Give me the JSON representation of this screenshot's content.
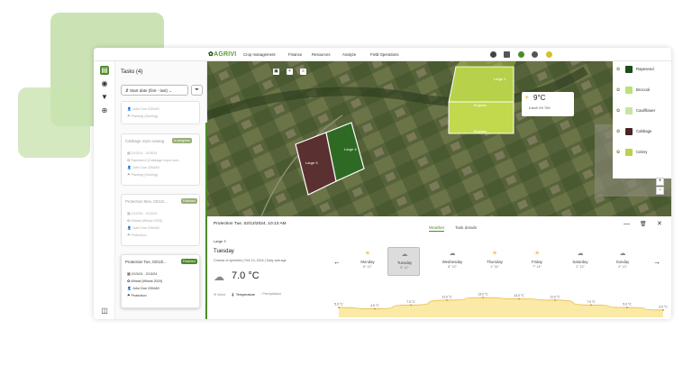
{
  "app": {
    "logo": "AGRIVI"
  },
  "nav": [
    "Crop management",
    "Finance",
    "Resources",
    "Analyze",
    "Field Operations"
  ],
  "tasks_panel": {
    "title": "Tasks (4)",
    "sort_label": "Start date (first - last)",
    "cards": [
      {
        "title": "",
        "badge": "",
        "lines": [
          "John Doe 235440",
          "Planting (Sowing)"
        ]
      },
      {
        "title": "Cabbage repro sowing",
        "badge": "In progress",
        "lines": [
          "2/13/24 - 3/15/24",
          "Rapeseed (Cabbage repro sow...",
          "John Doe 235440",
          "Planting (Sowing)"
        ]
      },
      {
        "title": "Protection Mon, 02/12/...",
        "badge": "Finished",
        "lines": [
          "2/12/24 - 2/12/24",
          "Wheat (Wheat 2020)",
          "John Doe 235440",
          "Protection"
        ]
      },
      {
        "title": "Protection Tue, 02/13/...",
        "badge": "Finished",
        "lines": [
          "2/13/24 - 2/13/24",
          "Wheat (Wheat 2020)",
          "John Doe 235440",
          "Protection"
        ]
      }
    ]
  },
  "map": {
    "field_labels": [
      "Large 1",
      "Large 5",
      "Large 4",
      "Bogdan",
      "Bogdan"
    ],
    "temp_popup": {
      "temp": "9°C",
      "details": "8 km/h  0%  76%"
    }
  },
  "legend": [
    {
      "label": "Rapeseed",
      "color": "#1e4d1c"
    },
    {
      "label": "Broccoli",
      "color": "#b9e07a"
    },
    {
      "label": "Cauliflower",
      "color": "#c7e4a5"
    },
    {
      "label": "Cabbage",
      "color": "#4a2525"
    },
    {
      "label": "Celery",
      "color": "#b7d34a"
    }
  ],
  "details": {
    "title": "Protection Tue, 02/13/2024, 10:13 AM",
    "tabs": [
      "Weather",
      "Task details"
    ],
    "field": "Large 3",
    "day": "Tuesday",
    "sub": "Chance of sprinkles  |  Feb 13, 2024  |  Daily average",
    "temp": "7.0 °C",
    "metrics": [
      "Wind",
      "Temperature",
      "Precipitation"
    ]
  },
  "forecast": [
    {
      "name": "Monday",
      "range": "6° 12°",
      "icon": "sun-icon"
    },
    {
      "name": "Tuesday",
      "range": "5° 11°",
      "icon": "cloud-icon"
    },
    {
      "name": "Wednesday",
      "range": "8° 13°",
      "icon": "cloud-icon"
    },
    {
      "name": "Thursday",
      "range": "1° 14°",
      "icon": "sun-icon"
    },
    {
      "name": "Friday",
      "range": "7° 14°",
      "icon": "sun-icon"
    },
    {
      "name": "Saturday",
      "range": "2° 13°",
      "icon": "cloud-icon"
    },
    {
      "name": "Sunday",
      "range": "4° 13°",
      "icon": "cloud-icon"
    }
  ],
  "temp_line": {
    "labels": [
      "5.0 °C",
      "4.0 °C",
      "7.0 °C",
      "11.0 °C",
      "13.0 °C",
      "12.0 °C",
      "11.0 °C",
      "7.0 °C",
      "5.0 °C",
      "3.0 °C"
    ],
    "values": [
      5,
      4,
      7,
      11,
      13,
      12,
      11,
      7,
      5,
      3
    ]
  }
}
